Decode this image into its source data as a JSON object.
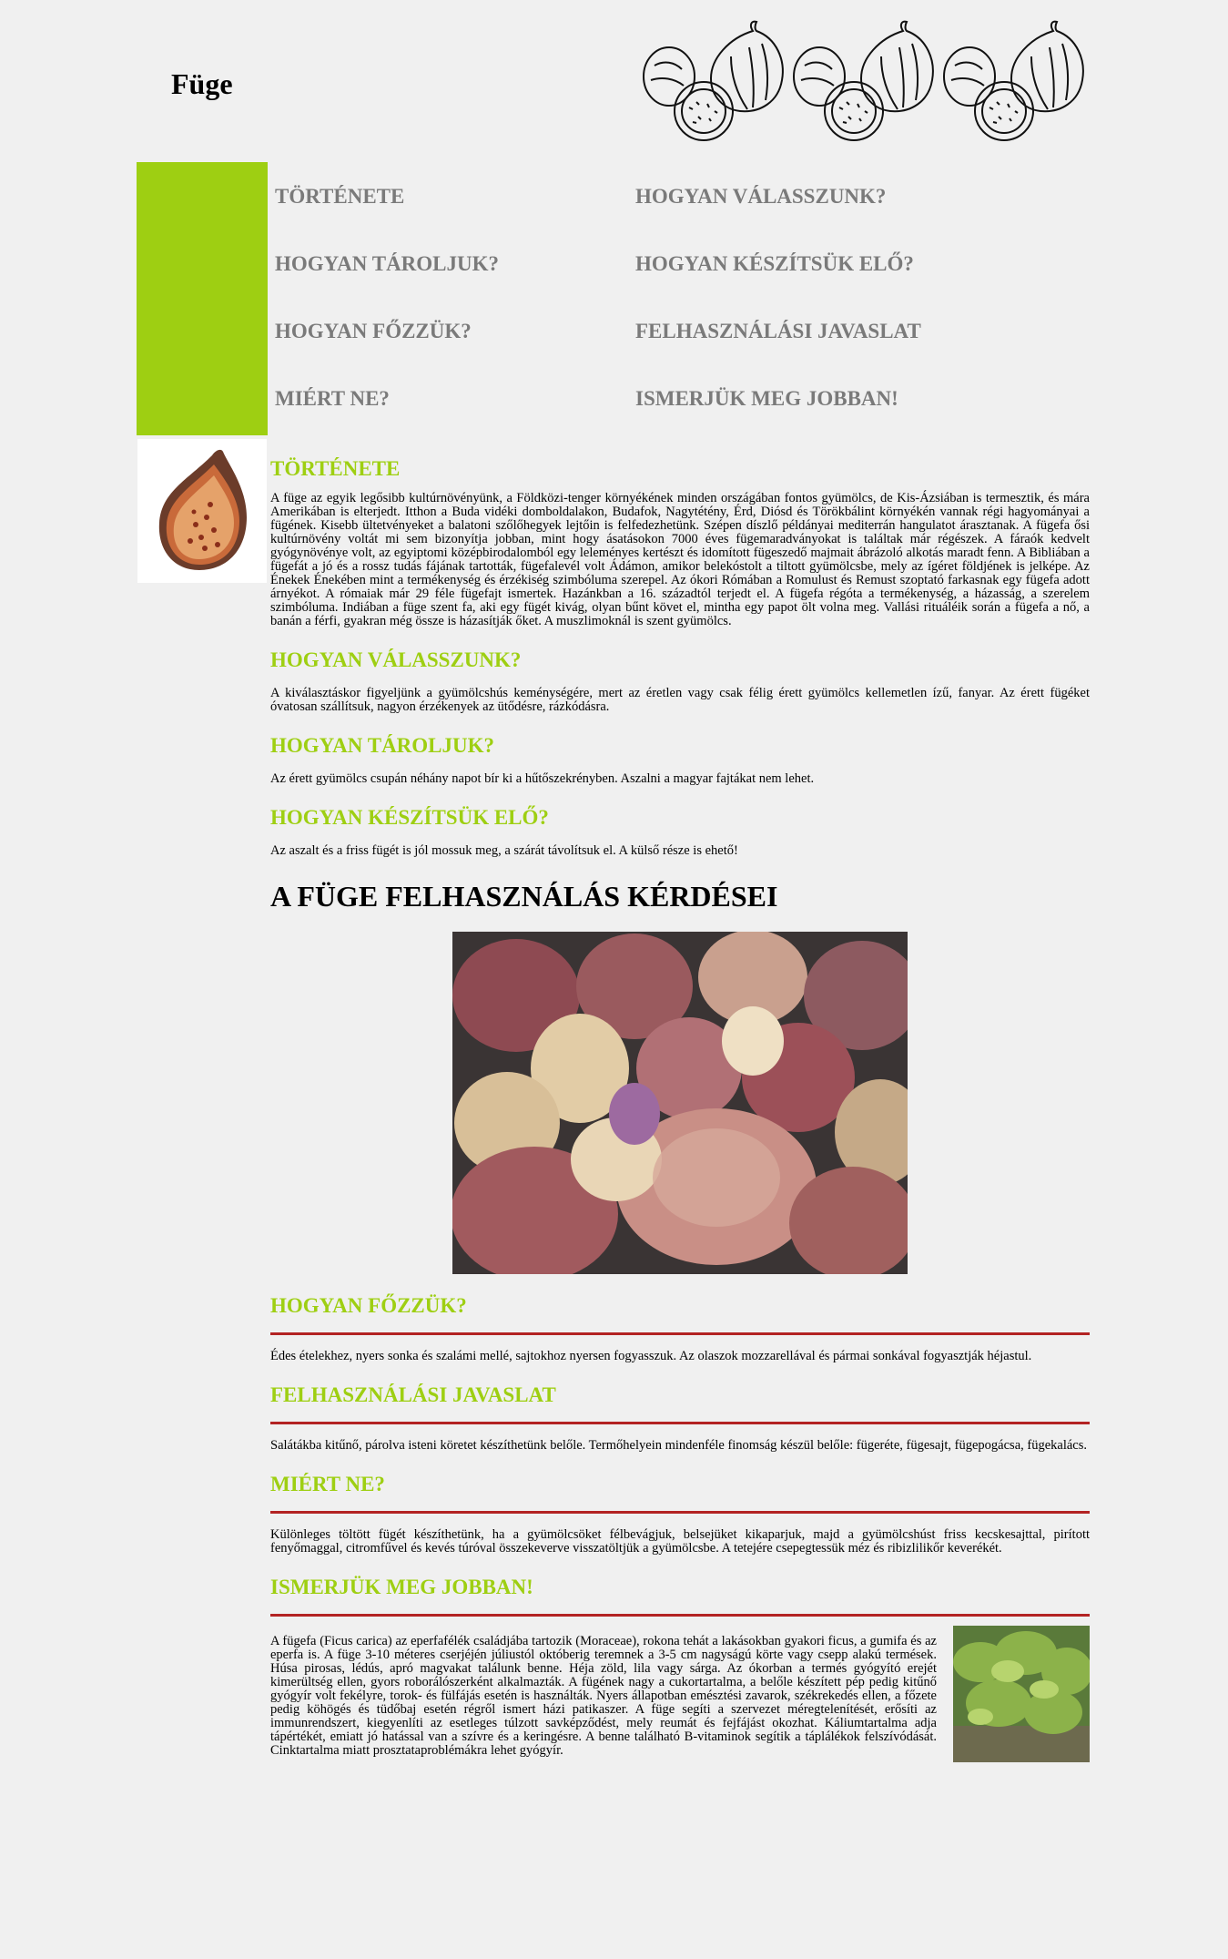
{
  "site_title": "Füge",
  "nav": [
    "TÖRTÉNETE",
    "HOGYAN VÁLASSZUNK?",
    "HOGYAN TÁROLJUK?",
    "HOGYAN KÉSZÍTSÜK ELŐ?",
    "HOGYAN FŐZZÜK?",
    "FELHASZNÁLÁSI JAVASLAT",
    "MIÉRT NE?",
    "ISMERJÜK MEG JOBBAN!"
  ],
  "sections": {
    "tortenete": {
      "heading": "TÖRTÉNETE",
      "text": "A füge az egyik legősibb kultúrnövényünk, a Földközi-tenger környékének minden országában fontos gyümölcs, de Kis-Ázsiában is termesztik, és mára Amerikában is elterjedt. Itthon a Buda vidéki domboldalakon, Budafok, Nagytétény, Érd, Diósd és Törökbálint környékén vannak régi hagyományai a fügének. Kisebb ültetvényeket a balatoni szőlőhegyek lejtőin is felfedezhetünk. Szépen díszlő példányai mediterrán hangulatot árasztanak. A fügefa ősi kultúrnövény voltát mi sem bizonyítja jobban, mint hogy ásatásokon 7000 éves fügemaradványokat is találtak már régészek. A fáraók kedvelt gyógynövénye volt, az egyiptomi középbirodalomból egy leleményes kertészt és idomított fügeszedő majmait ábrázoló alkotás maradt fenn. A Bibliában a fügefát a jó és a rossz tudás fájának tartották, fügefalevél volt Ádámon, amikor belekóstolt a tiltott gyümölcsbe, mely az ígéret földjének is jelképe. Az Énekek Énekében mint a termékenység és érzékiség szimbóluma szerepel. Az ókori Rómában a Romulust és Remust szoptató farkasnak egy fügefa adott árnyékot. A rómaiak már 29 féle fügefajt ismertek. Hazánkban a 16. századtól terjedt el. A fügefa régóta a termékenység, a házasság, a szerelem szimbóluma. Indiában a füge szent fa, aki egy fügét kivág, olyan bűnt követ el, mintha egy papot ölt volna meg. Vallási rituáléik során a fügefa a nő, a banán a férfi, gyakran még össze is házasítják őket. A muszlimoknál is szent gyümölcs."
    },
    "valasszunk": {
      "heading": "HOGYAN VÁLASSZUNK?",
      "text": "A kiválasztáskor figyeljünk a gyümölcshús keménységére, mert az éretlen vagy csak félig érett gyümölcs kellemetlen ízű, fanyar. Az érett fügéket óvatosan szállítsuk, nagyon érzékenyek az ütődésre, rázkódásra."
    },
    "taroljuk": {
      "heading": "HOGYAN TÁROLJUK?",
      "text": "Az érett gyümölcs csupán néhány napot bír ki a hűtőszekrényben. Aszalni a magyar fajtákat nem lehet."
    },
    "keszitsuk": {
      "heading": "HOGYAN KÉSZÍTSÜK ELŐ?",
      "text": "Az aszalt és a friss fügét is jól mossuk meg, a szárát távolítsuk el. A külső része is ehető!"
    },
    "big_title": "A FÜGE FELHASZNÁLÁS KÉRDÉSEI",
    "fozzuk": {
      "heading": "HOGYAN FŐZZÜK?",
      "text": "Édes ételekhez, nyers sonka és szalámi mellé, sajtokhoz nyersen fogyasszuk. Az olaszok mozzarellával és pármai sonkával fogyasztják héjastul."
    },
    "javaslat": {
      "heading": "FELHASZNÁLÁSI JAVASLAT",
      "text": "Salátákba kitűnő, párolva isteni köretet készíthetünk belőle. Termőhelyein mindenféle finomság készül belőle: fügeréte, fügesajt, fügepogácsa, fügekalács."
    },
    "mierrt": {
      "heading": "MIÉRT NE?",
      "text": "Különleges töltött fügét készíthetünk, ha a gyümölcsöket félbevágjuk, belsejüket kikaparjuk, majd a gyümölcshúst friss kecskesajttal, pirított fenyőmaggal, citromfűvel és kevés túróval összekeverve visszatöltjük a gyümölcsbe. A tetejére csepegtessük méz és ribizlilikőr keverékét."
    },
    "ismerjuk": {
      "heading": "ISMERJÜK MEG JOBBAN!",
      "text": "A fügefa (Ficus carica) az eperfafélék családjába tartozik (Moraceae), rokona tehát a lakásokban gyakori ficus, a gumifa és az eperfa is. A füge 3-10 méteres cserjéjén júliustól októberig teremnek a 3-5 cm nagyságú körte vagy csepp alakú termések. Húsa pirosas, lédús, apró magvakat találunk benne. Héja zöld, lila vagy sárga. Az ókorban a termés gyógyító erejét kimerültség ellen, gyors roborálószerként alkalmazták. A fügének nagy a cukortartalma, a belőle készített pép pedig kitűnő gyógyír volt fekélyre, torok- és fülfájás esetén is használták. Nyers állapotban emésztési zavarok, székrekedés ellen, a főzete pedig köhögés és tüdőbaj esetén régről ismert házi patikaszer. A füge segíti a szervezet méregtelenítését, erősíti az immunrendszert, kiegyenlíti az esetleges túlzott savképződést, mely reumát és fejfájást okozhat. Káliumtartalma adja tápértékét, emiatt jó hatással van a szívre és a keringésre. A benne található B-vitaminok segítik a táplálékok felszívódását. Cinktartalma miatt prosztataproblémákra lehet gyógyír."
    }
  },
  "colors": {
    "accent_green": "#9ecf12",
    "rule_red": "#b32323",
    "nav_grey": "#7a7a7a"
  }
}
